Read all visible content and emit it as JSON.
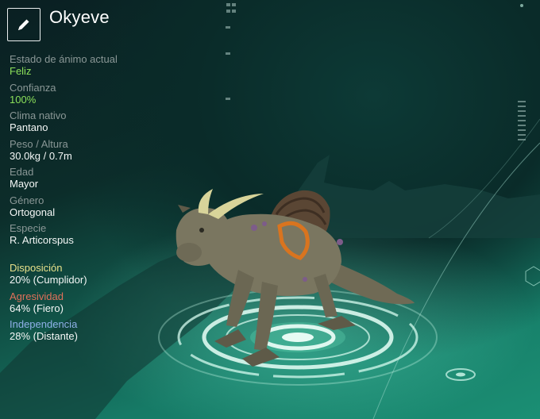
{
  "creature": {
    "name": "Okyeve",
    "stats": [
      {
        "label": "Estado de ánimo actual",
        "value": "Feliz"
      },
      {
        "label": "Confianza",
        "value": "100%"
      },
      {
        "label": "Clima nativo",
        "value": "Pantano"
      },
      {
        "label": "Peso / Altura",
        "value": "30.0kg / 0.7m"
      },
      {
        "label": "Edad",
        "value": "Mayor"
      },
      {
        "label": "Género",
        "value": "Ortogonal"
      },
      {
        "label": "Especie",
        "value": "R. Articorspus"
      }
    ],
    "traits": [
      {
        "label": "Disposición",
        "value": "20% (Cumplidor)",
        "color": "#e7e08a"
      },
      {
        "label": "Agresividad",
        "value": "64% (Fiero)",
        "color": "#e0705a"
      },
      {
        "label": "Independencia",
        "value": "28% (Distante)",
        "color": "#8fb0e8"
      }
    ]
  },
  "icons": {
    "edit": "pencil-icon"
  },
  "colors": {
    "positive": "#8ce05a",
    "label": "#8a9796",
    "value": "#f4f7f6"
  }
}
